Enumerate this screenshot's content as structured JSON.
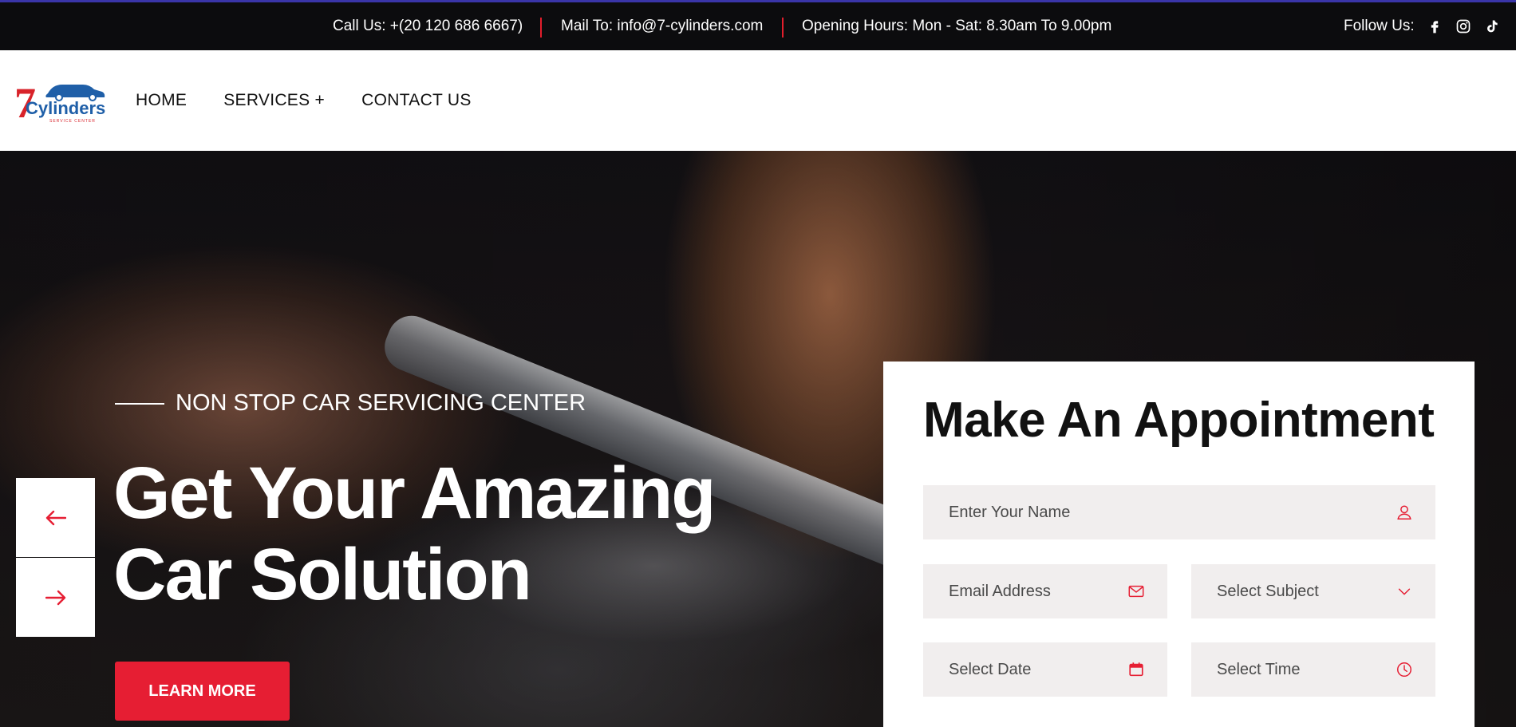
{
  "topbar": {
    "call": "Call Us: +(20 120 686 6667)",
    "mail": "Mail To: info@7-cylinders.com",
    "hours": "Opening Hours: Mon - Sat: 8.30am To 9.00pm",
    "follow_label": "Follow Us:",
    "social_icons": [
      "facebook-icon",
      "instagram-icon",
      "tiktok-icon"
    ]
  },
  "header": {
    "logo": {
      "number": "7",
      "name": "Cylinders",
      "tagline": "SERVICE CENTER"
    },
    "nav": [
      "HOME",
      "SERVICES +",
      "CONTACT US"
    ]
  },
  "hero": {
    "subtitle": "NON STOP CAR SERVICING CENTER",
    "headline_line1": "Get Your Amazing",
    "headline_line2": "Car Solution",
    "cta": "LEARN MORE"
  },
  "appointment": {
    "title": "Make An Appointment",
    "name_placeholder": "Enter Your Name",
    "email_placeholder": "Email Address",
    "subject_placeholder": "Select Subject",
    "date_placeholder": "Select Date",
    "time_placeholder": "Select Time"
  },
  "colors": {
    "accent": "#e61e33",
    "topbar_bg": "#0c0c0e",
    "field_bg": "#f1eeee"
  }
}
